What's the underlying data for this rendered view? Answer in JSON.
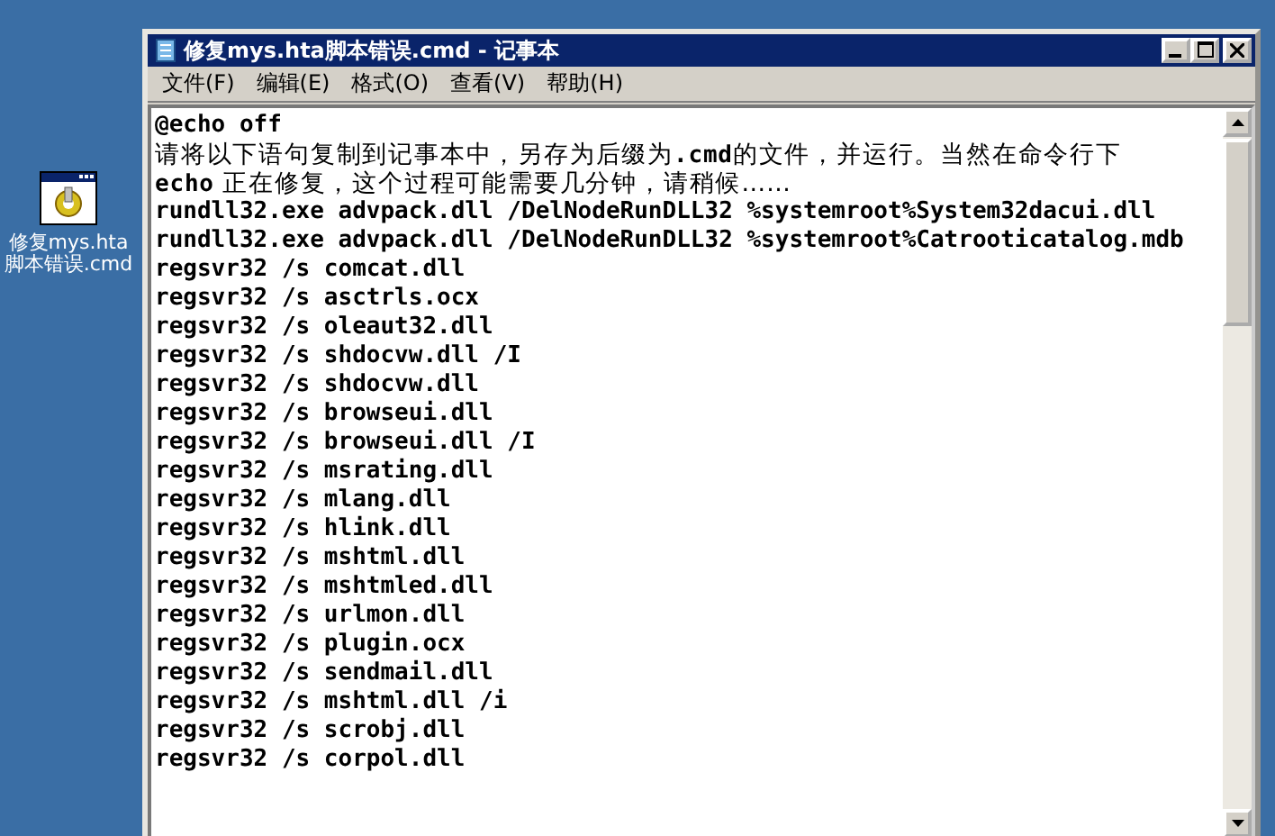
{
  "desktop_icon": {
    "label_lines": [
      "修复mys.hta",
      "脚本错误.cmd"
    ]
  },
  "window": {
    "title": "修复mys.hta脚本错误.cmd - 记事本"
  },
  "menu": [
    "文件(F)",
    "编辑(E)",
    "格式(O)",
    "查看(V)",
    "帮助(H)"
  ],
  "lines": [
    {
      "kind": "code",
      "text": "@echo off"
    },
    {
      "kind": "text",
      "text": "请将以下语句复制到记事本中，另存为后缀为**.cmd**的文件，并运行。当然在命令行下"
    },
    {
      "kind": "text",
      "text": "**echo** 正在修复，这个过程可能需要几分钟，请稍候……"
    },
    {
      "kind": "code",
      "text": "rundll32.exe advpack.dll /DelNodeRunDLL32 %systemroot%System32dacui.dll"
    },
    {
      "kind": "code",
      "text": "rundll32.exe advpack.dll /DelNodeRunDLL32 %systemroot%Catrooticatalog.mdb"
    },
    {
      "kind": "code",
      "text": "regsvr32 /s comcat.dll"
    },
    {
      "kind": "code",
      "text": "regsvr32 /s asctrls.ocx"
    },
    {
      "kind": "code",
      "text": "regsvr32 /s oleaut32.dll"
    },
    {
      "kind": "code",
      "text": "regsvr32 /s shdocvw.dll /I"
    },
    {
      "kind": "code",
      "text": "regsvr32 /s shdocvw.dll"
    },
    {
      "kind": "code",
      "text": "regsvr32 /s browseui.dll"
    },
    {
      "kind": "code",
      "text": "regsvr32 /s browseui.dll /I"
    },
    {
      "kind": "code",
      "text": "regsvr32 /s msrating.dll"
    },
    {
      "kind": "code",
      "text": "regsvr32 /s mlang.dll"
    },
    {
      "kind": "code",
      "text": "regsvr32 /s hlink.dll"
    },
    {
      "kind": "code",
      "text": "regsvr32 /s mshtml.dll"
    },
    {
      "kind": "code",
      "text": "regsvr32 /s mshtmled.dll"
    },
    {
      "kind": "code",
      "text": "regsvr32 /s urlmon.dll"
    },
    {
      "kind": "code",
      "text": "regsvr32 /s plugin.ocx"
    },
    {
      "kind": "code",
      "text": "regsvr32 /s sendmail.dll"
    },
    {
      "kind": "code",
      "text": "regsvr32 /s mshtml.dll /i"
    },
    {
      "kind": "code",
      "text": "regsvr32 /s scrobj.dll"
    },
    {
      "kind": "code",
      "text": "regsvr32 /s corpol.dll"
    }
  ]
}
